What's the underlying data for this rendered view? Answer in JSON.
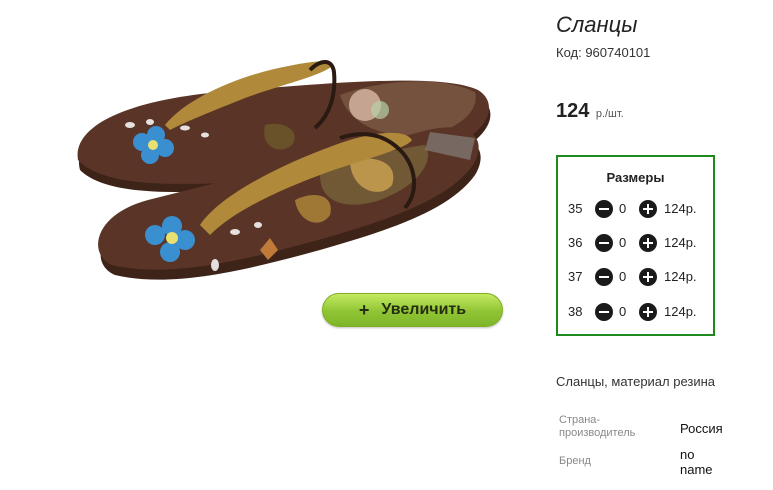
{
  "product": {
    "title": "Сланцы",
    "code": "Код: 960740101",
    "price": "124",
    "price_unit": "р./шт."
  },
  "image": {
    "zoom_label": "Увеличить",
    "zoom_icon": "plus-icon"
  },
  "sizes": {
    "title": "Размеры",
    "rows": [
      {
        "size": "35",
        "qty": "0",
        "price": "124р."
      },
      {
        "size": "36",
        "qty": "0",
        "price": "124р."
      },
      {
        "size": "37",
        "qty": "0",
        "price": "124р."
      },
      {
        "size": "38",
        "qty": "0",
        "price": "124р."
      }
    ],
    "border_color": "#1e8a1e"
  },
  "description": "Сланцы, материал резина",
  "attributes": [
    {
      "label": "Страна-производитель",
      "value": "Россия"
    },
    {
      "label": "Бренд",
      "value": "no name"
    }
  ],
  "colors": {
    "sole": "#4a2c1f",
    "strap": "#b08a3a",
    "zoom_button": "#8fc434"
  }
}
